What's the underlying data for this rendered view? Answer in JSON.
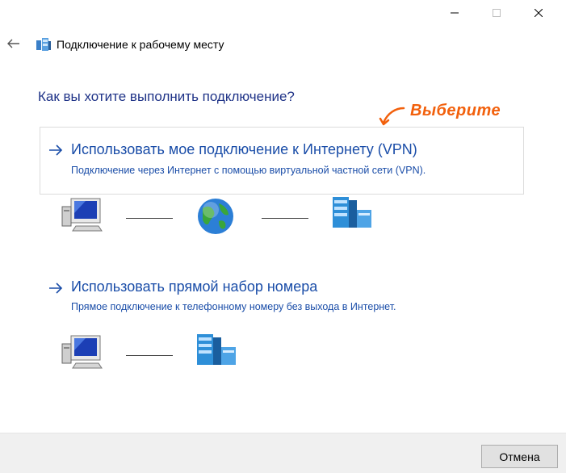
{
  "window": {
    "controls": [
      "minimize-icon",
      "maximize-icon",
      "close-icon"
    ]
  },
  "header": {
    "title": "Подключение к рабочему месту",
    "back_icon": "back-arrow-icon",
    "app_icon": "workplace-connection-icon"
  },
  "main": {
    "question": "Как вы хотите выполнить подключение?",
    "annotation": "Выберите",
    "options": [
      {
        "title": "Использовать мое подключение к Интернету (VPN)",
        "description": "Подключение через Интернет с помощью виртуальной частной сети (VPN).",
        "diagram": [
          "computer-icon",
          "globe-icon",
          "server-icon"
        ]
      },
      {
        "title": "Использовать прямой набор номера",
        "description": "Прямое подключение к телефонному номеру без выхода в Интернет.",
        "diagram": [
          "computer-icon",
          "server-icon"
        ]
      }
    ]
  },
  "footer": {
    "cancel_label": "Отмена"
  },
  "colors": {
    "link_blue": "#1a4da8",
    "heading_blue": "#1e3287",
    "annotation_orange": "#f2600c"
  }
}
